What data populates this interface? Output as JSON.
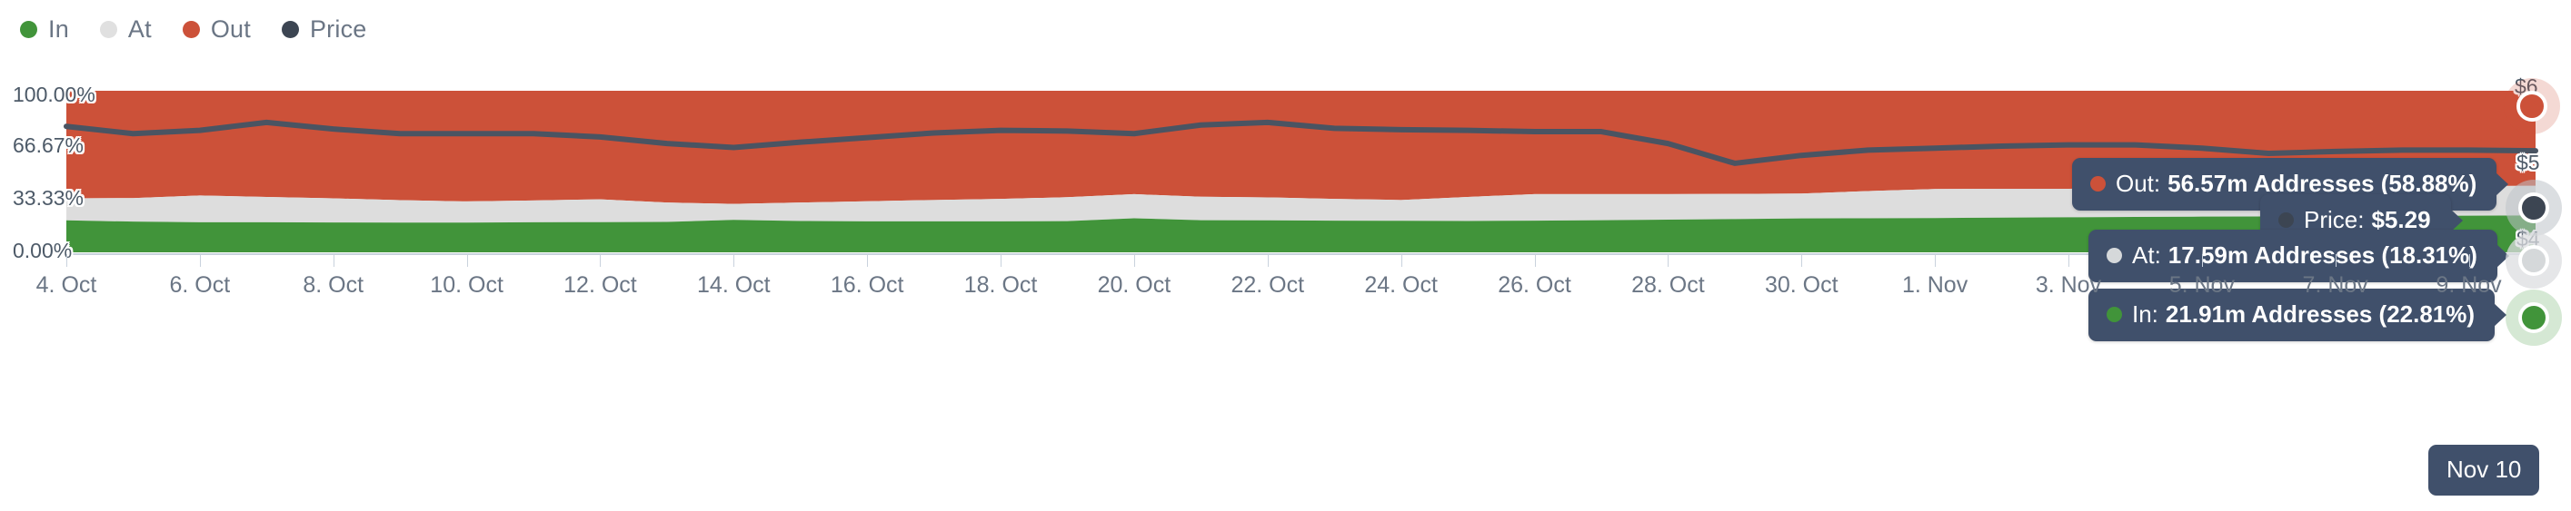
{
  "legend": {
    "items": [
      {
        "label": "In",
        "color": "#41943a",
        "icon": "legend-dot-icon"
      },
      {
        "label": "At",
        "color": "#e0e0e0",
        "icon": "legend-dot-icon"
      },
      {
        "label": "Out",
        "color": "#cc5139",
        "icon": "legend-dot-icon"
      },
      {
        "label": "Price",
        "color": "#3c4552",
        "icon": "legend-dot-icon"
      }
    ]
  },
  "tooltips": {
    "out": {
      "key": "Out:",
      "value": "56.57m Addresses (58.88%)",
      "color": "#cc5139"
    },
    "price": {
      "key": "Price:",
      "value": "$5.29",
      "color": "#3c4552"
    },
    "at": {
      "key": "At:",
      "value": "17.59m Addresses (18.31%)",
      "color": "#d5d8da"
    },
    "in": {
      "key": "In:",
      "value": "21.91m Addresses (22.81%)",
      "color": "#41943a"
    },
    "date": "Nov 10"
  },
  "axes": {
    "y_left_labels": [
      "100.00%",
      "66.67%",
      "33.33%",
      "0.00%"
    ],
    "y_right_labels": [
      "$6",
      "$5",
      "$4"
    ],
    "x_labels": [
      "4. Oct",
      "6. Oct",
      "8. Oct",
      "10. Oct",
      "12. Oct",
      "14. Oct",
      "16. Oct",
      "18. Oct",
      "20. Oct",
      "22. Oct",
      "24. Oct",
      "26. Oct",
      "28. Oct",
      "30. Oct",
      "1. Nov",
      "3. Nov",
      "5. Nov",
      "7. Nov",
      "9. Nov"
    ]
  },
  "chart_data": {
    "type": "area",
    "title": "",
    "xlabel": "",
    "ylabel": "",
    "ylim": [
      0,
      100
    ],
    "ylim_right": [
      3.75,
      6.2
    ],
    "grid": false,
    "legend_position": "top-left",
    "stacked": true,
    "normalized_percent": true,
    "x": [
      "4. Oct",
      "5. Oct",
      "6. Oct",
      "7. Oct",
      "8. Oct",
      "9. Oct",
      "10. Oct",
      "11. Oct",
      "12. Oct",
      "13. Oct",
      "14. Oct",
      "15. Oct",
      "16. Oct",
      "17. Oct",
      "18. Oct",
      "19. Oct",
      "20. Oct",
      "21. Oct",
      "22. Oct",
      "23. Oct",
      "24. Oct",
      "25. Oct",
      "26. Oct",
      "27. Oct",
      "28. Oct",
      "29. Oct",
      "30. Oct",
      "31. Oct",
      "1. Nov",
      "2. Nov",
      "3. Nov",
      "4. Nov",
      "5. Nov",
      "6. Nov",
      "7. Nov",
      "8. Nov",
      "9. Nov",
      "10. Nov"
    ],
    "series": [
      {
        "name": "In",
        "color": "#41943a",
        "unit": "%",
        "values": [
          19.8,
          19.0,
          18.6,
          18.6,
          18.5,
          18.4,
          18.4,
          18.6,
          18.7,
          18.8,
          20.1,
          19.4,
          19.2,
          19.2,
          19.2,
          19.3,
          21.1,
          19.9,
          19.8,
          19.6,
          19.5,
          19.4,
          19.6,
          19.9,
          20.2,
          20.6,
          21.0,
          21.1,
          21.2,
          21.5,
          21.7,
          21.9,
          22.1,
          22.2,
          22.4,
          22.6,
          22.7,
          22.81
        ]
      },
      {
        "name": "At",
        "color": "#dddddd",
        "unit": "%",
        "values": [
          13.6,
          14.6,
          16.6,
          15.7,
          14.9,
          13.9,
          13.1,
          13.5,
          14.1,
          12.0,
          9.9,
          11.4,
          12.4,
          13.2,
          13.9,
          14.8,
          14.9,
          14.5,
          14.2,
          13.5,
          12.9,
          14.9,
          16.4,
          16.1,
          15.8,
          15.6,
          15.4,
          16.8,
          18.0,
          17.8,
          17.6,
          17.9,
          18.1,
          18.2,
          18.3,
          18.3,
          18.3,
          18.31
        ]
      },
      {
        "name": "Out",
        "color": "#cc5139",
        "unit": "%",
        "values": [
          66.6,
          66.4,
          64.8,
          65.7,
          66.6,
          67.7,
          68.5,
          67.9,
          67.2,
          69.2,
          70.0,
          69.2,
          68.4,
          67.6,
          66.9,
          65.9,
          64.0,
          65.6,
          66.0,
          66.9,
          67.6,
          65.7,
          64.0,
          64.0,
          64.0,
          63.8,
          63.6,
          62.1,
          60.8,
          60.7,
          60.7,
          60.2,
          59.8,
          59.6,
          59.3,
          59.1,
          59.0,
          58.88
        ]
      },
      {
        "name": "Price",
        "color": "#4a5462",
        "unit": "$",
        "axis": "right",
        "values": [
          5.66,
          5.55,
          5.6,
          5.72,
          5.62,
          5.55,
          5.55,
          5.55,
          5.5,
          5.4,
          5.34,
          5.42,
          5.49,
          5.56,
          5.6,
          5.59,
          5.55,
          5.68,
          5.72,
          5.63,
          5.61,
          5.6,
          5.58,
          5.58,
          5.4,
          5.1,
          5.22,
          5.3,
          5.33,
          5.36,
          5.38,
          5.38,
          5.33,
          5.25,
          5.28,
          5.3,
          5.3,
          5.29
        ]
      }
    ]
  },
  "colors": {
    "in": "#41943a",
    "at": "#e0e0e0",
    "out": "#cc5139",
    "price": "#4a5462",
    "tooltip_bg": "#40506b",
    "axis_text": "#6b7685",
    "tick": "#c9d2dd",
    "background": "#ffffff"
  }
}
